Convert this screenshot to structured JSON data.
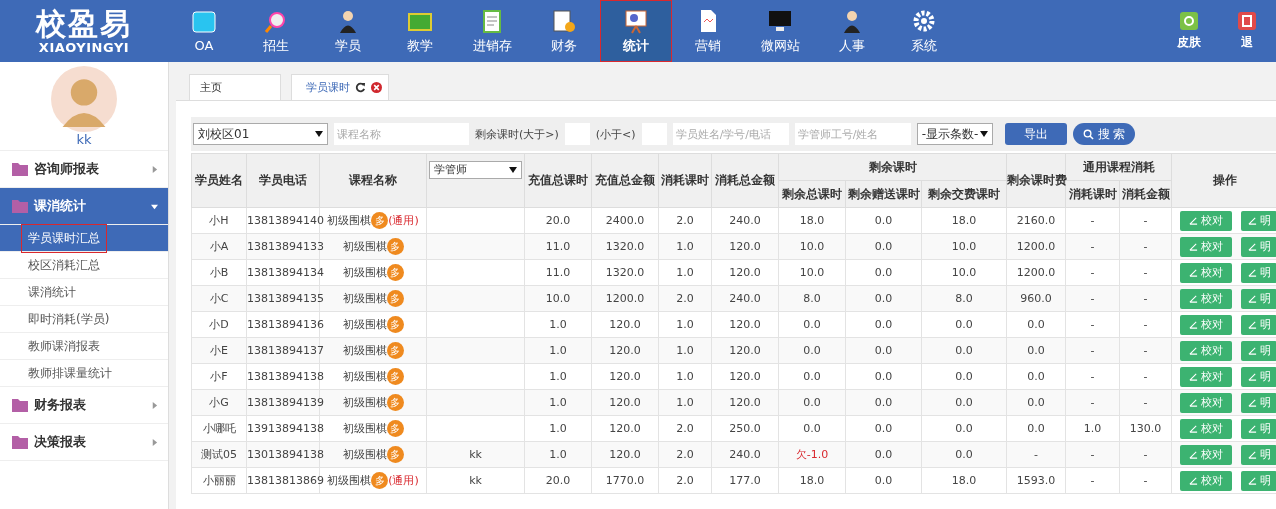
{
  "logo": {
    "title": "校盈易",
    "subtitle": "XIAOYINGYI"
  },
  "nav": [
    {
      "label": "OA",
      "selected": false
    },
    {
      "label": "招生",
      "selected": false
    },
    {
      "label": "学员",
      "selected": false
    },
    {
      "label": "教学",
      "selected": false
    },
    {
      "label": "进销存",
      "selected": false
    },
    {
      "label": "财务",
      "selected": false
    },
    {
      "label": "统计",
      "selected": true
    },
    {
      "label": "营销",
      "selected": false
    },
    {
      "label": "微网站",
      "selected": false
    },
    {
      "label": "人事",
      "selected": false
    },
    {
      "label": "系统",
      "selected": false
    }
  ],
  "nav_right": [
    {
      "label": "皮肤"
    },
    {
      "label": "退"
    }
  ],
  "user": {
    "name": "kk"
  },
  "sidebar": [
    {
      "label": "咨询师报表",
      "expanded": false
    },
    {
      "label": "课消统计",
      "expanded": true,
      "children": [
        {
          "label": "学员课时汇总",
          "selected": true
        },
        {
          "label": "校区消耗汇总",
          "selected": false
        },
        {
          "label": "课消统计",
          "selected": false
        },
        {
          "label": "即时消耗(学员)",
          "selected": false
        },
        {
          "label": "教师课消报表",
          "selected": false
        },
        {
          "label": "教师排课量统计",
          "selected": false
        }
      ]
    },
    {
      "label": "财务报表",
      "expanded": false
    },
    {
      "label": "决策报表",
      "expanded": false
    }
  ],
  "tabs": [
    {
      "label": "主页",
      "selected": false,
      "closable": false
    },
    {
      "label": "学员课时",
      "selected": true,
      "closable": true
    }
  ],
  "filters": {
    "campus": "刘校区01",
    "course_placeholder": "课程名称",
    "more_than_label": "剩余课时(大于>)",
    "less_than_label": "(小于<)",
    "student_placeholder": "学员姓名/学号/电话",
    "manager_placeholder": "学管师工号/姓名",
    "page_size": "-显示条数-",
    "export": "导出",
    "search": "搜 索"
  },
  "table": {
    "columns": [
      {
        "label": "学员姓名"
      },
      {
        "label": "学员电话"
      },
      {
        "label": "课程名称"
      },
      {
        "label": "学管师",
        "kind": "select"
      },
      {
        "label": "充值总课时"
      },
      {
        "label": "充值总金额"
      },
      {
        "label": "消耗课时"
      },
      {
        "label": "消耗总金额"
      },
      {
        "label": "剩余课时",
        "children": [
          "剩余总课时",
          "剩余赠送课时",
          "剩余交费课时"
        ]
      },
      {
        "label": "剩余课时费"
      },
      {
        "label": "通用课程消耗",
        "children": [
          "消耗课时",
          "消耗金额"
        ]
      },
      {
        "label": "操作"
      }
    ],
    "rows": [
      {
        "name": "小H",
        "phone": "13813894140",
        "course": "初级围棋",
        "badge": "多",
        "general": "(通用)",
        "manager": "",
        "values": [
          "20.0",
          "2400.0",
          "2.0",
          "240.0",
          "18.0",
          "0.0",
          "18.0",
          "2160.0",
          "-",
          "-"
        ],
        "owed": false,
        "actions": [
          "校对",
          "明"
        ]
      },
      {
        "name": "小A",
        "phone": "13813894133",
        "course": "初级围棋",
        "badge": "多",
        "manager": "",
        "values": [
          "11.0",
          "1320.0",
          "1.0",
          "120.0",
          "10.0",
          "0.0",
          "10.0",
          "1200.0",
          "-",
          "-"
        ],
        "owed": false,
        "actions": [
          "校对",
          "明"
        ]
      },
      {
        "name": "小B",
        "phone": "13813894134",
        "course": "初级围棋",
        "badge": "多",
        "manager": "",
        "values": [
          "11.0",
          "1320.0",
          "1.0",
          "120.0",
          "10.0",
          "0.0",
          "10.0",
          "1200.0",
          "-",
          "-"
        ],
        "owed": false,
        "actions": [
          "校对",
          "明"
        ]
      },
      {
        "name": "小C",
        "phone": "13813894135",
        "course": "初级围棋",
        "badge": "多",
        "manager": "",
        "values": [
          "10.0",
          "1200.0",
          "2.0",
          "240.0",
          "8.0",
          "0.0",
          "8.0",
          "960.0",
          "-",
          "-"
        ],
        "owed": false,
        "actions": [
          "校对",
          "明"
        ]
      },
      {
        "name": "小D",
        "phone": "13813894136",
        "course": "初级围棋",
        "badge": "多",
        "manager": "",
        "values": [
          "1.0",
          "120.0",
          "1.0",
          "120.0",
          "0.0",
          "0.0",
          "0.0",
          "0.0",
          "-",
          "-"
        ],
        "owed": false,
        "actions": [
          "校对",
          "明"
        ]
      },
      {
        "name": "小E",
        "phone": "13813894137",
        "course": "初级围棋",
        "badge": "多",
        "manager": "",
        "values": [
          "1.0",
          "120.0",
          "1.0",
          "120.0",
          "0.0",
          "0.0",
          "0.0",
          "0.0",
          "-",
          "-"
        ],
        "owed": false,
        "actions": [
          "校对",
          "明"
        ]
      },
      {
        "name": "小F",
        "phone": "13813894138",
        "course": "初级围棋",
        "badge": "多",
        "manager": "",
        "values": [
          "1.0",
          "120.0",
          "1.0",
          "120.0",
          "0.0",
          "0.0",
          "0.0",
          "0.0",
          "-",
          "-"
        ],
        "owed": false,
        "actions": [
          "校对",
          "明"
        ]
      },
      {
        "name": "小G",
        "phone": "13813894139",
        "course": "初级围棋",
        "badge": "多",
        "manager": "",
        "values": [
          "1.0",
          "120.0",
          "1.0",
          "120.0",
          "0.0",
          "0.0",
          "0.0",
          "0.0",
          "-",
          "-"
        ],
        "owed": false,
        "actions": [
          "校对",
          "明"
        ]
      },
      {
        "name": "小哪吒",
        "phone": "13913894138",
        "course": "初级围棋",
        "badge": "多",
        "manager": "",
        "values": [
          "1.0",
          "120.0",
          "2.0",
          "250.0",
          "0.0",
          "0.0",
          "0.0",
          "0.0",
          "1.0",
          "130.0"
        ],
        "owed": false,
        "actions": [
          "校对",
          "明"
        ]
      },
      {
        "name": "测试05",
        "phone": "13013894138",
        "course": "初级围棋",
        "badge": "多",
        "manager": "kk",
        "values": [
          "1.0",
          "120.0",
          "2.0",
          "240.0",
          "欠-1.0",
          "0.0",
          "0.0",
          "-",
          "-",
          "-"
        ],
        "owed": true,
        "actions": [
          "校对",
          "明"
        ]
      },
      {
        "name": "小丽丽",
        "phone": "13813813869",
        "course": "初级围棋",
        "badge": "多",
        "general": "(通用)",
        "manager": "kk",
        "values": [
          "20.0",
          "1770.0",
          "2.0",
          "177.0",
          "18.0",
          "0.0",
          "18.0",
          "1593.0",
          "-",
          "-"
        ],
        "owed": false,
        "actions": [
          "校对",
          "明"
        ]
      }
    ]
  }
}
